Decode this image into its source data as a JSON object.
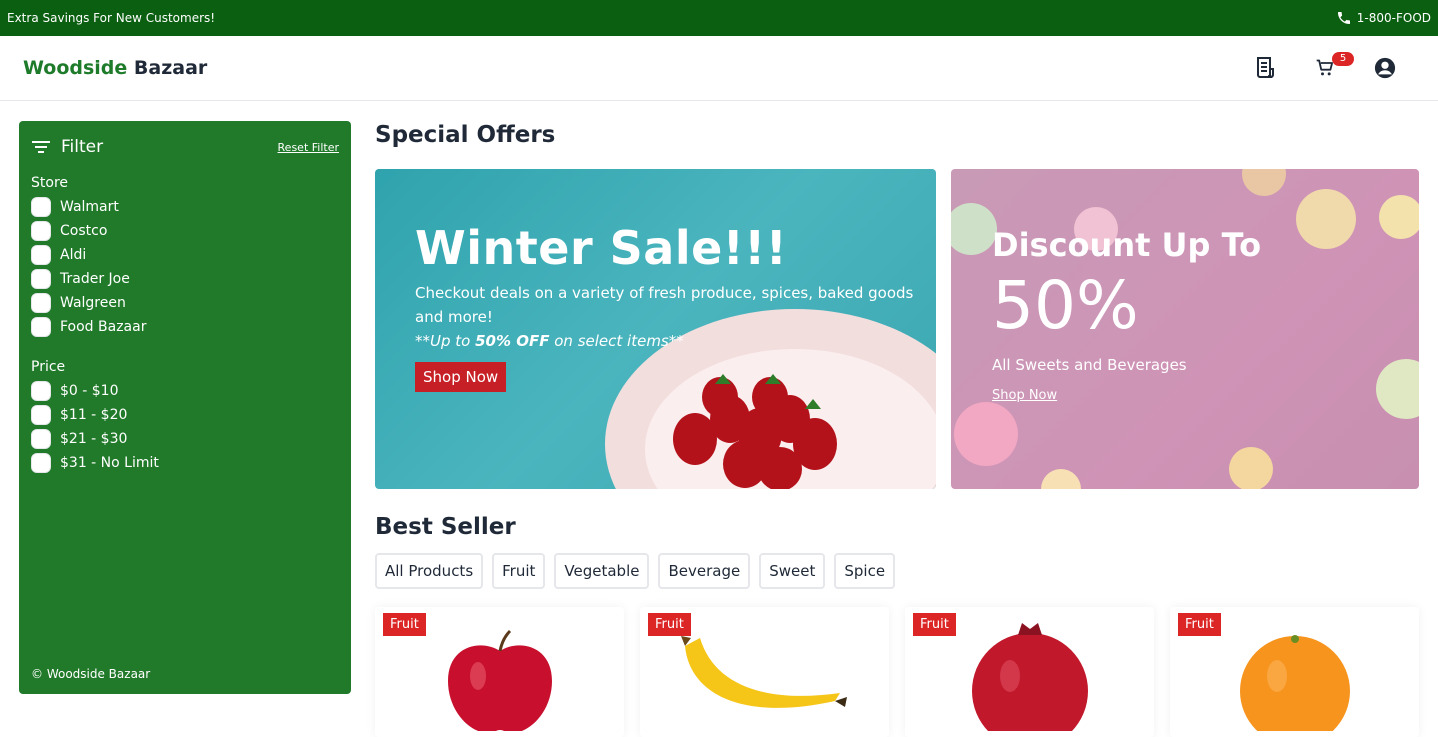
{
  "topbar": {
    "promo": "Extra Savings For New Customers!",
    "phone": "1-800-FOOD"
  },
  "header": {
    "brand_part1": "Woodside",
    "brand_part2": "Bazaar",
    "cart_count": "5",
    "icons": [
      "receipt-icon",
      "cart-icon",
      "account-icon"
    ]
  },
  "sidebar": {
    "title": "Filter",
    "reset_label": "Reset Filter",
    "store_label": "Store",
    "stores": [
      "Walmart",
      "Costco",
      "Aldi",
      "Trader Joe",
      "Walgreen",
      "Food Bazaar"
    ],
    "price_label": "Price",
    "prices": [
      "$0 - $10",
      "$11 - $20",
      "$21 - $30",
      "$31 - No Limit"
    ],
    "copyright": "© Woodside Bazaar"
  },
  "offers": {
    "title": "Special Offers",
    "banner1": {
      "heading": "Winter Sale!!!",
      "text": "Checkout deals on a variety of fresh produce, spices, baked goods and more!",
      "note_prefix": "**Up to ",
      "note_bold": "50% OFF",
      "note_suffix": " on select items**",
      "button": "Shop Now"
    },
    "banner2": {
      "heading": "Discount Up To",
      "percent": "50%",
      "sub": "All Sweets and Beverages",
      "link": "Shop Now"
    }
  },
  "best": {
    "title": "Best Seller",
    "tabs": [
      "All Products",
      "Fruit",
      "Vegetable",
      "Beverage",
      "Sweet",
      "Spice"
    ],
    "products": [
      {
        "tag": "Fruit",
        "image": "apple"
      },
      {
        "tag": "Fruit",
        "image": "banana"
      },
      {
        "tag": "Fruit",
        "image": "pomegranate"
      },
      {
        "tag": "Fruit",
        "image": "orange"
      }
    ]
  },
  "colors": {
    "topbar": "#0b5f10",
    "sidebar": "#217a2a",
    "accent_red": "#c62026",
    "brand_green": "#1e7b2a"
  }
}
